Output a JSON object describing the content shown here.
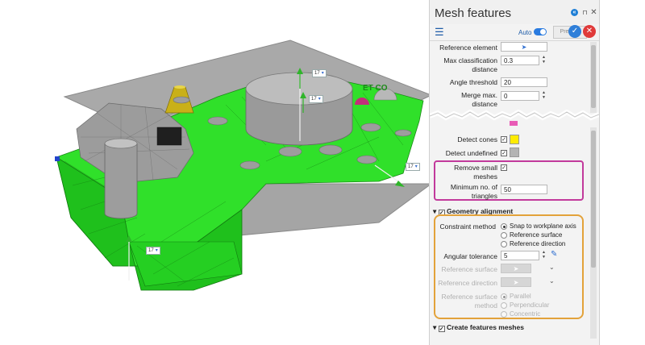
{
  "viewport": {
    "dim_tags": [
      {
        "value": "17"
      },
      {
        "value": "17"
      },
      {
        "value": "17"
      },
      {
        "value": "17"
      }
    ]
  },
  "panel": {
    "title": "Mesh features",
    "toolbar": {
      "auto_label": "Auto",
      "preview_label": "Preview"
    },
    "fields": {
      "reference_element_label": "Reference element",
      "max_classification_label_1": "Max classification",
      "max_classification_label_2": "distance",
      "max_classification_value": "0.3",
      "angle_threshold_label": "Angle threshold",
      "angle_threshold_value": "20",
      "merge_max_label_1": "Merge max.",
      "merge_max_label_2": "distance",
      "merge_max_value": "0",
      "detect_cones_label": "Detect cones",
      "detect_undefined_label": "Detect undefined",
      "remove_small_label_1": "Remove small",
      "remove_small_label_2": "meshes",
      "min_triangles_label_1": "Minimum no. of",
      "min_triangles_label_2": "triangles",
      "min_triangles_value": "50"
    },
    "geometry_alignment": {
      "header": "Geometry alignment",
      "constraint_label": "Constraint method",
      "options": [
        "Snap to workplane axis",
        "Reference surface",
        "Reference direction"
      ],
      "angular_tolerance_label": "Angular tolerance",
      "angular_tolerance_value": "5",
      "reference_surface_label": "Reference surface",
      "reference_direction_label": "Reference direction",
      "ref_method_label_1": "Reference surface",
      "ref_method_label_2": "method",
      "method_options": [
        "Parallel",
        "Perpendicular",
        "Concentric"
      ]
    },
    "create_meshes_header": "Create features meshes"
  },
  "colors": {
    "accent": "#2f7fd9",
    "cancel": "#e03a3a",
    "mesh_green": "#2fe12a",
    "cone_swatch": "#ffeb00",
    "undefined_swatch": "#b3b3b3",
    "highlight_magenta": "#c23a9c",
    "highlight_orange": "#e3a23a"
  }
}
